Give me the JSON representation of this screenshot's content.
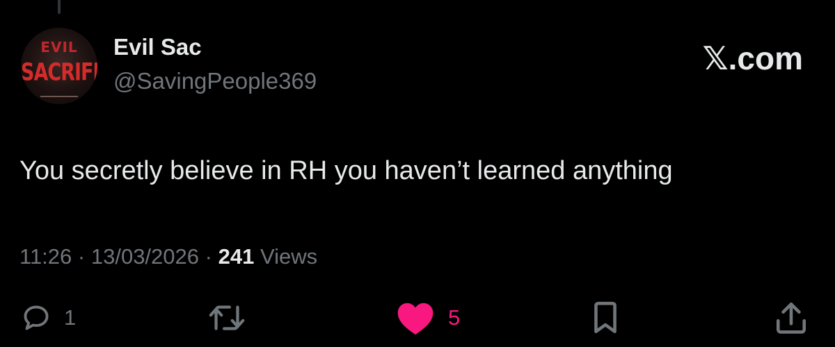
{
  "colors": {
    "background": "#000000",
    "primary_text": "#e7e9ea",
    "secondary_text": "#71767b",
    "like_active": "#f91880"
  },
  "author": {
    "display_name": "Evil Sac",
    "handle": "@SavingPeople369",
    "avatar_art": {
      "top_text": "EVIL",
      "main_text": "SACRIFICE"
    }
  },
  "brand": {
    "label": "𝕏.com"
  },
  "tweet": {
    "text": "You secretly believe in RH you haven’t learned anything",
    "time": "11:26",
    "date": "13/03/2026",
    "separator": "·",
    "views_count": "241",
    "views_label": "Views"
  },
  "actions": {
    "reply": {
      "icon": "reply-icon",
      "count": "1"
    },
    "repost": {
      "icon": "repost-icon",
      "count": ""
    },
    "like": {
      "icon": "heart-icon",
      "count": "5",
      "active": true
    },
    "bookmark": {
      "icon": "bookmark-icon",
      "count": ""
    },
    "share": {
      "icon": "share-icon",
      "count": ""
    }
  }
}
